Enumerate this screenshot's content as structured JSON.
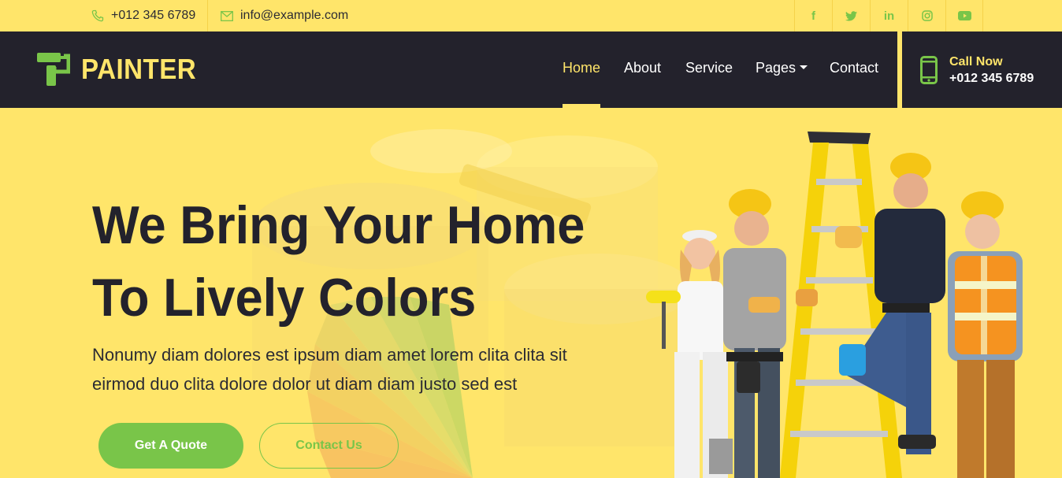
{
  "topbar": {
    "phone": "+012 345 6789",
    "email": "info@example.com",
    "social": [
      {
        "icon": "facebook-icon",
        "glyph": "f"
      },
      {
        "icon": "twitter-icon",
        "glyph": "t"
      },
      {
        "icon": "linkedin-icon",
        "glyph": "in"
      },
      {
        "icon": "instagram-icon",
        "glyph": "◎"
      },
      {
        "icon": "youtube-icon",
        "glyph": "▶"
      }
    ]
  },
  "navbar": {
    "brand": "PAINTER",
    "links": [
      "Home",
      "About",
      "Service",
      "Pages",
      "Contact"
    ],
    "active": "Home",
    "call_label": "Call Now",
    "call_number": "+012 345 6789"
  },
  "hero": {
    "title_line1": "We Bring Your Home",
    "title_line2": "To Lively Colors",
    "text_line1": "Nonumy diam dolores est ipsum diam amet lorem clita clita sit",
    "text_line2": "eirmod duo clita dolore dolor ut diam diam justo sed est",
    "primary_button": "Get A Quote",
    "secondary_button": "Contact Us"
  },
  "colors": {
    "yellow": "#ffe56a",
    "dark": "#23222c",
    "green": "#79c549"
  }
}
